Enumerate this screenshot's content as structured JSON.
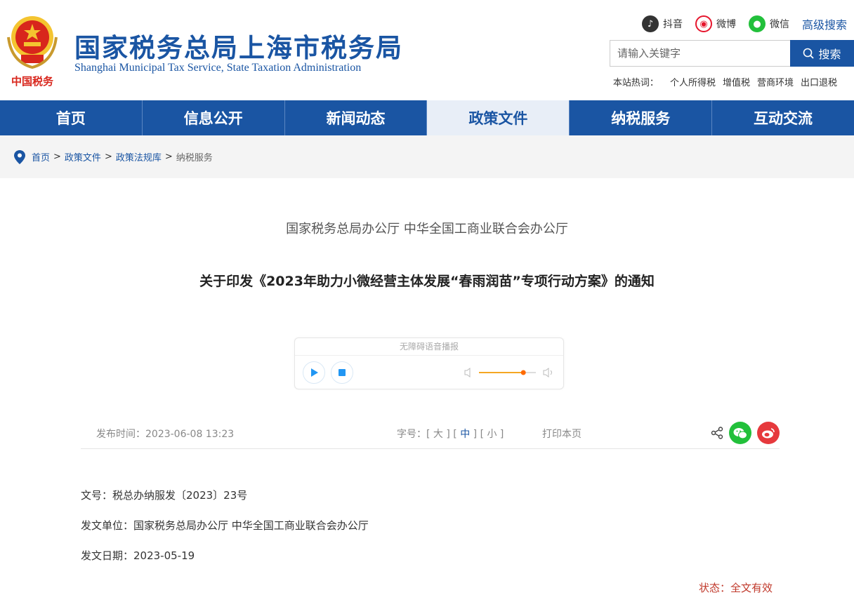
{
  "header": {
    "emblem_text": "中国税务",
    "title": "国家税务总局上海市税务局",
    "subtitle": "Shanghai Municipal Tax Service, State Taxation Administration"
  },
  "social": [
    {
      "label": "抖音",
      "icon": "douyin-icon",
      "color": "#333333"
    },
    {
      "label": "微博",
      "icon": "weibo-icon",
      "color": "#e6162d"
    },
    {
      "label": "微信",
      "icon": "wechat-icon",
      "color": "#22c03b"
    }
  ],
  "advanced_search": "高级搜索",
  "search": {
    "placeholder": "请输入关键字",
    "button": "搜索"
  },
  "hot": {
    "label": "本站热词：",
    "words": [
      "个人所得税",
      "增值税",
      "营商环境",
      "出口退税"
    ]
  },
  "nav": [
    {
      "label": "首页"
    },
    {
      "label": "信息公开"
    },
    {
      "label": "新闻动态"
    },
    {
      "label": "政策文件",
      "active": true
    },
    {
      "label": "纳税服务"
    },
    {
      "label": "互动交流"
    }
  ],
  "breadcrumb": [
    "首页",
    "政策文件",
    "政策法规库",
    "纳税服务"
  ],
  "article": {
    "issuer": "国家税务总局办公厅 中华全国工商业联合会办公厅",
    "title": "关于印发《2023年助力小微经营主体发展“春雨润苗”专项行动方案》的通知",
    "player_title": "无障碍语音播报",
    "volume": 0.78,
    "publish_time": "发布时间：2023-06-08 13:23",
    "font_label": "字号：",
    "font_sizes": [
      "大",
      "中",
      "小"
    ],
    "print": "打印本页",
    "doc_no": "文号：税总办纳服发〔2023〕23号",
    "unit": "发文单位：国家税务总局办公厅 中华全国工商业联合会办公厅",
    "date": "发文日期：2023-05-19",
    "status": "状态：全文有效"
  },
  "colors": {
    "brand": "#1a55a3",
    "status": "#c0392b"
  }
}
